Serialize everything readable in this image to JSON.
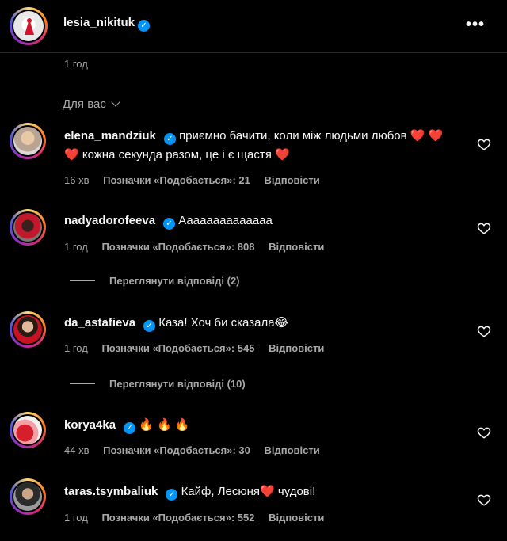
{
  "header": {
    "username": "lesia_nikituk",
    "verified_mark": "✓",
    "more_icon": "more-horizontal-icon",
    "more_label": "•••"
  },
  "post_time": "1 год",
  "section_label": "Для вас",
  "accent_colors": {
    "verified": "#0095f6",
    "secondary_text": "#a8a8a8",
    "background": "#000000"
  },
  "comments": [
    {
      "username": "elena_mandziuk",
      "text": "приємно бачити, коли між людьми любов ❤️ ❤️ ❤️  кожна секунда разом, це і є щастя ❤️",
      "time": "16 хв",
      "likes": "Позначки «Подобається»: 21",
      "reply": "Відповісти"
    },
    {
      "username": "nadyadorofeeva",
      "text": "Аааааааааааааа",
      "time": "1 год",
      "likes": "Позначки «Подобається»: 808",
      "reply": "Відповісти",
      "view_replies": "Переглянути відповіді (2)"
    },
    {
      "username": "da_astafieva",
      "text": "Каза! Хоч би сказала😂",
      "time": "1 год",
      "likes": "Позначки «Подобається»: 545",
      "reply": "Відповісти",
      "view_replies": "Переглянути відповіді (10)"
    },
    {
      "username": "korya4ka",
      "text": "🔥 🔥 🔥",
      "time": "44 хв",
      "likes": "Позначки «Подобається»: 30",
      "reply": "Відповісти"
    },
    {
      "username": "taras.tsymbaliuk",
      "text": "Кайф, Лесюня❤️  чудові!",
      "time": "1 год",
      "likes": "Позначки «Подобається»: 552",
      "reply": "Відповісти"
    }
  ]
}
